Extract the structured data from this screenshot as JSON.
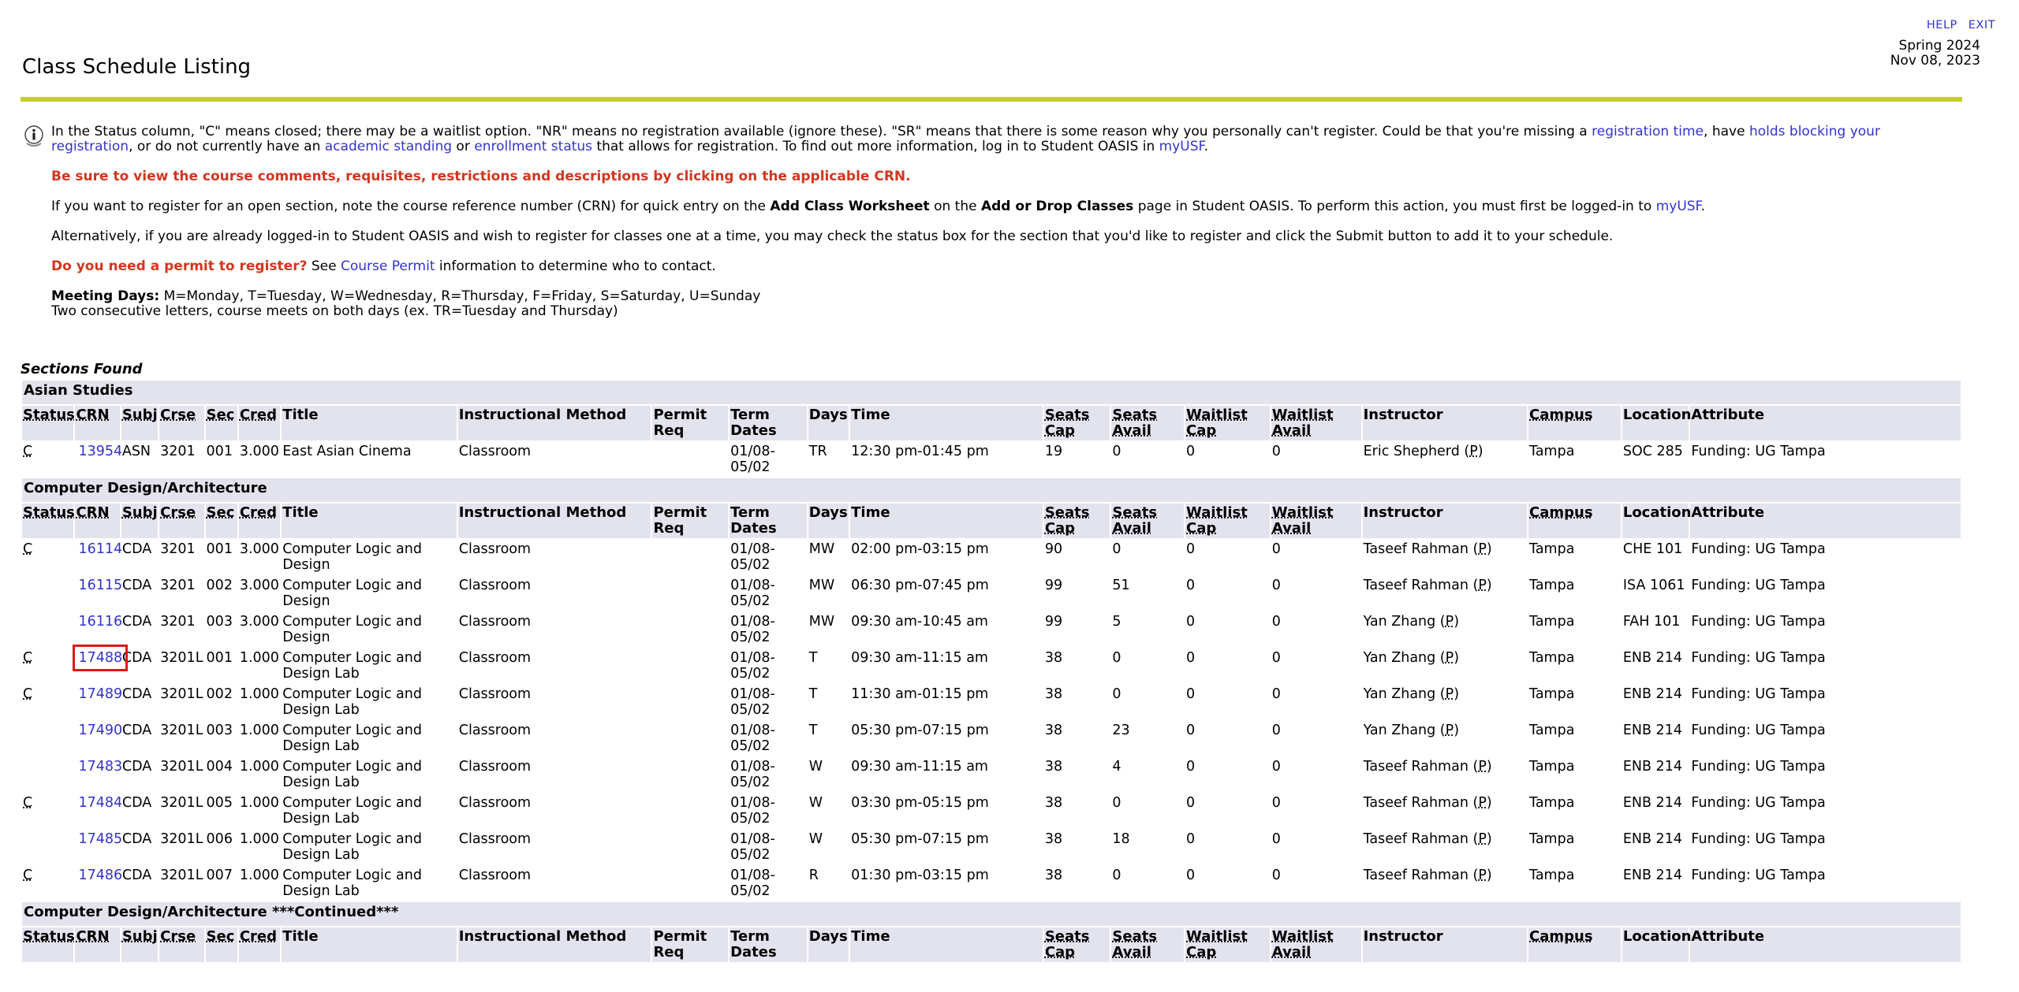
{
  "header": {
    "help": "HELP",
    "exit": "EXIT",
    "title": "Class Schedule Listing",
    "term": "Spring 2024",
    "date": "Nov 08, 2023"
  },
  "info": {
    "p1_a": "In the Status column, \"C\" means closed; there may be a waitlist option. \"NR\" means no registration available (ignore these). \"SR\" means that there is some reason why you personally can't register. Could be that you're missing a ",
    "link_registration_time": "registration time",
    "p1_b": ", have ",
    "link_holds": "holds blocking your registration",
    "p1_c": ", or do not currently have an ",
    "link_academic_standing": "academic standing",
    "p1_d": " or ",
    "link_enrollment_status": "enrollment status",
    "p1_e": " that allows for registration. To find out more information, log in to Student OASIS in ",
    "link_myusf": "myUSF",
    "p1_f": ".",
    "warning": "Be sure to view the course comments, requisites, restrictions and descriptions by clicking on the applicable CRN.",
    "p3_a": "If you want to register for an open section, note the course reference number (CRN) for quick entry on the ",
    "p3_b": "Add Class Worksheet",
    "p3_c": " on the ",
    "p3_d": "Add or Drop Classes",
    "p3_e": " page in Student OASIS. To perform this action, you must first be logged-in to ",
    "p3_link": "myUSF",
    "p3_f": ".",
    "p4": "Alternatively, if you are already logged-in to Student OASIS and wish to register for classes one at a time, you may check the status box for the section that you'd like to register and click the Submit button to add it to your schedule.",
    "permit_q": "Do you need a permit to register?",
    "permit_a": " See ",
    "permit_link": "Course Permit",
    "permit_b": " information to determine who to contact.",
    "days_label": "Meeting Days:",
    "days_text": " M=Monday, T=Tuesday, W=Wednesday, R=Thursday, F=Friday, S=Saturday, U=Sunday",
    "days_note": "Two consecutive letters, course meets on both days (ex. TR=Tuesday and Thursday)"
  },
  "sections_found": "Sections Found",
  "columns": [
    "Status",
    "CRN",
    "Subj",
    "Crse",
    "Sec",
    "Cred",
    "Title",
    "Instructional Method",
    "Permit Req",
    "Term Dates",
    "Days",
    "Time",
    "Seats Cap",
    "Seats Avail",
    "Waitlist Cap",
    "Waitlist Avail",
    "Instructor",
    "Campus",
    "Location",
    "Attribute"
  ],
  "groups": [
    {
      "name": "Asian Studies",
      "rows": [
        {
          "status": "C",
          "crn": "13954",
          "subj": "ASN",
          "crse": "3201",
          "sec": "001",
          "cred": "3.000",
          "title": "East Asian Cinema",
          "method": "Classroom",
          "permit": "",
          "dates": "01/08-05/02",
          "days": "TR",
          "time": "12:30 pm-01:45 pm",
          "cap": "19",
          "avail": "0",
          "wcap": "0",
          "wavail": "0",
          "instructor": "Eric Shepherd",
          "p": "P",
          "campus": "Tampa",
          "location": "SOC 285",
          "attribute": "Funding: UG Tampa"
        }
      ]
    },
    {
      "name": "Computer Design/Architecture",
      "rows": [
        {
          "status": "C",
          "crn": "16114",
          "subj": "CDA",
          "crse": "3201",
          "sec": "001",
          "cred": "3.000",
          "title": "Computer Logic and Design",
          "method": "Classroom",
          "permit": "",
          "dates": "01/08-05/02",
          "days": "MW",
          "time": "02:00 pm-03:15 pm",
          "cap": "90",
          "avail": "0",
          "wcap": "0",
          "wavail": "0",
          "instructor": "Taseef Rahman",
          "p": "P",
          "campus": "Tampa",
          "location": "CHE 101",
          "attribute": "Funding: UG Tampa"
        },
        {
          "status": "",
          "crn": "16115",
          "subj": "CDA",
          "crse": "3201",
          "sec": "002",
          "cred": "3.000",
          "title": "Computer Logic and Design",
          "method": "Classroom",
          "permit": "",
          "dates": "01/08-05/02",
          "days": "MW",
          "time": "06:30 pm-07:45 pm",
          "cap": "99",
          "avail": "51",
          "wcap": "0",
          "wavail": "0",
          "instructor": "Taseef Rahman",
          "p": "P",
          "campus": "Tampa",
          "location": "ISA 1061",
          "attribute": "Funding: UG Tampa"
        },
        {
          "status": "",
          "crn": "16116",
          "subj": "CDA",
          "crse": "3201",
          "sec": "003",
          "cred": "3.000",
          "title": "Computer Logic and Design",
          "method": "Classroom",
          "permit": "",
          "dates": "01/08-05/02",
          "days": "MW",
          "time": "09:30 am-10:45 am",
          "cap": "99",
          "avail": "5",
          "wcap": "0",
          "wavail": "0",
          "instructor": "Yan Zhang",
          "p": "P",
          "campus": "Tampa",
          "location": "FAH 101",
          "attribute": "Funding: UG Tampa"
        },
        {
          "status": "C",
          "crn": "17488",
          "subj": "CDA",
          "crse": "3201L",
          "sec": "001",
          "cred": "1.000",
          "title": "Computer Logic and Design Lab",
          "method": "Classroom",
          "permit": "",
          "dates": "01/08-05/02",
          "days": "T",
          "time": "09:30 am-11:15 am",
          "cap": "38",
          "avail": "0",
          "wcap": "0",
          "wavail": "0",
          "instructor": "Yan Zhang",
          "p": "P",
          "campus": "Tampa",
          "location": "ENB 214",
          "attribute": "Funding: UG Tampa",
          "highlight": true
        },
        {
          "status": "C",
          "crn": "17489",
          "subj": "CDA",
          "crse": "3201L",
          "sec": "002",
          "cred": "1.000",
          "title": "Computer Logic and Design Lab",
          "method": "Classroom",
          "permit": "",
          "dates": "01/08-05/02",
          "days": "T",
          "time": "11:30 am-01:15 pm",
          "cap": "38",
          "avail": "0",
          "wcap": "0",
          "wavail": "0",
          "instructor": "Yan Zhang",
          "p": "P",
          "campus": "Tampa",
          "location": "ENB 214",
          "attribute": "Funding: UG Tampa"
        },
        {
          "status": "",
          "crn": "17490",
          "subj": "CDA",
          "crse": "3201L",
          "sec": "003",
          "cred": "1.000",
          "title": "Computer Logic and Design Lab",
          "method": "Classroom",
          "permit": "",
          "dates": "01/08-05/02",
          "days": "T",
          "time": "05:30 pm-07:15 pm",
          "cap": "38",
          "avail": "23",
          "wcap": "0",
          "wavail": "0",
          "instructor": "Yan Zhang",
          "p": "P",
          "campus": "Tampa",
          "location": "ENB 214",
          "attribute": "Funding: UG Tampa"
        },
        {
          "status": "",
          "crn": "17483",
          "subj": "CDA",
          "crse": "3201L",
          "sec": "004",
          "cred": "1.000",
          "title": "Computer Logic and Design Lab",
          "method": "Classroom",
          "permit": "",
          "dates": "01/08-05/02",
          "days": "W",
          "time": "09:30 am-11:15 am",
          "cap": "38",
          "avail": "4",
          "wcap": "0",
          "wavail": "0",
          "instructor": "Taseef Rahman",
          "p": "P",
          "campus": "Tampa",
          "location": "ENB 214",
          "attribute": "Funding: UG Tampa"
        },
        {
          "status": "C",
          "crn": "17484",
          "subj": "CDA",
          "crse": "3201L",
          "sec": "005",
          "cred": "1.000",
          "title": "Computer Logic and Design Lab",
          "method": "Classroom",
          "permit": "",
          "dates": "01/08-05/02",
          "days": "W",
          "time": "03:30 pm-05:15 pm",
          "cap": "38",
          "avail": "0",
          "wcap": "0",
          "wavail": "0",
          "instructor": "Taseef Rahman",
          "p": "P",
          "campus": "Tampa",
          "location": "ENB 214",
          "attribute": "Funding: UG Tampa"
        },
        {
          "status": "",
          "crn": "17485",
          "subj": "CDA",
          "crse": "3201L",
          "sec": "006",
          "cred": "1.000",
          "title": "Computer Logic and Design Lab",
          "method": "Classroom",
          "permit": "",
          "dates": "01/08-05/02",
          "days": "W",
          "time": "05:30 pm-07:15 pm",
          "cap": "38",
          "avail": "18",
          "wcap": "0",
          "wavail": "0",
          "instructor": "Taseef Rahman",
          "p": "P",
          "campus": "Tampa",
          "location": "ENB 214",
          "attribute": "Funding: UG Tampa"
        },
        {
          "status": "C",
          "crn": "17486",
          "subj": "CDA",
          "crse": "3201L",
          "sec": "007",
          "cred": "1.000",
          "title": "Computer Logic and Design Lab",
          "method": "Classroom",
          "permit": "",
          "dates": "01/08-05/02",
          "days": "R",
          "time": "01:30 pm-03:15 pm",
          "cap": "38",
          "avail": "0",
          "wcap": "0",
          "wavail": "0",
          "instructor": "Taseef Rahman",
          "p": "P",
          "campus": "Tampa",
          "location": "ENB 214",
          "attribute": "Funding: UG Tampa"
        }
      ]
    },
    {
      "name": "Computer Design/Architecture ***Continued***",
      "rows": []
    }
  ]
}
